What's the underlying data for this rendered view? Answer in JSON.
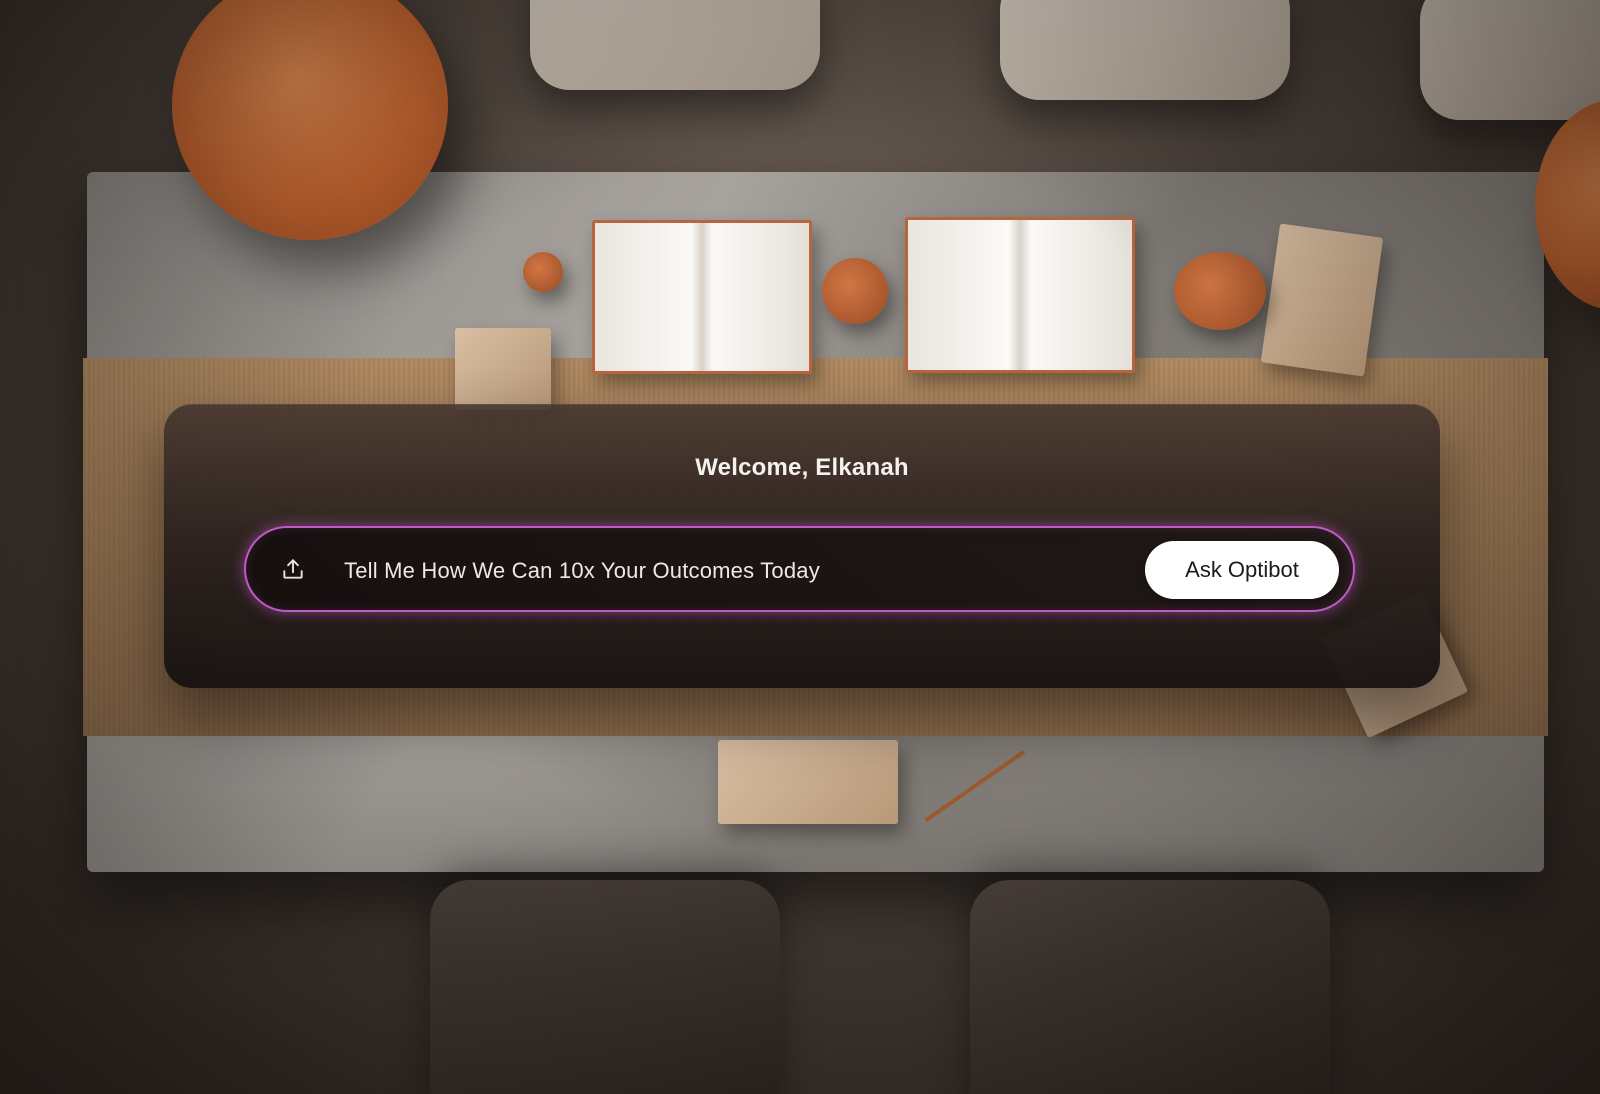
{
  "panel": {
    "welcome_text": "Welcome, Elkanah"
  },
  "prompt": {
    "placeholder": "Tell Me How We Can 10x Your Outcomes Today",
    "value": "",
    "upload_icon": "upload-icon",
    "submit_label": "Ask Optibot"
  },
  "colors": {
    "accent_glow": "#c05ac9",
    "button_bg": "#ffffff",
    "panel_bg": "#2a211e"
  }
}
